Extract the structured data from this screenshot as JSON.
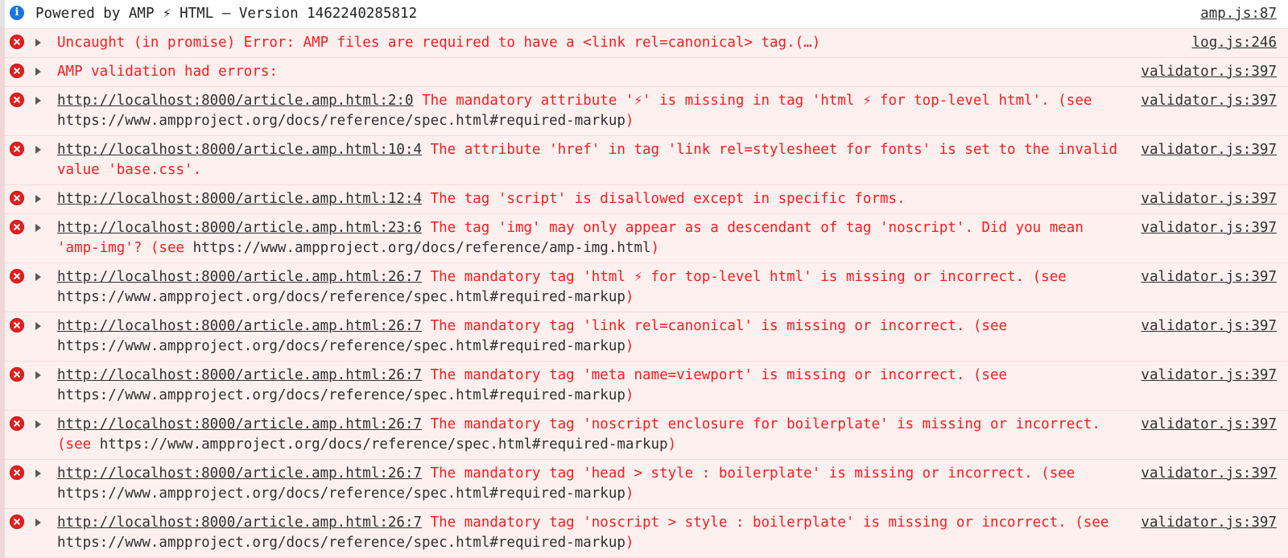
{
  "console": {
    "rows": [
      {
        "level": "info",
        "icon": "info-circle-icon",
        "has_arrow": false,
        "message": "Powered by AMP ⚡ HTML – Version 1462240285812",
        "source": "amp.js:87"
      },
      {
        "level": "error",
        "icon": "error-circle-icon",
        "has_arrow": true,
        "message": "Uncaught (in promise) Error: AMP files are required to have a <link rel=canonical> tag.(…)",
        "source": "log.js:246"
      },
      {
        "level": "error",
        "icon": "error-circle-icon",
        "has_arrow": true,
        "message": "AMP validation had errors:",
        "source": "validator.js:397"
      },
      {
        "level": "error",
        "icon": "error-circle-icon",
        "has_arrow": true,
        "location": "http://localhost:8000/article.amp.html:2:0",
        "message": "The mandatory attribute '⚡' is missing in tag 'html ⚡ for top-level html'. (see ",
        "url": "https://www.ampproject.org/docs/reference/spec.html#required-markup",
        "message_tail": ")",
        "source": "validator.js:397"
      },
      {
        "level": "error",
        "icon": "error-circle-icon",
        "has_arrow": true,
        "location": "http://localhost:8000/article.amp.html:10:4",
        "message": "The attribute 'href' in tag 'link rel=stylesheet for fonts' is set to the invalid value 'base.css'.",
        "url": "",
        "message_tail": "",
        "source": "validator.js:397"
      },
      {
        "level": "error",
        "icon": "error-circle-icon",
        "has_arrow": true,
        "location": "http://localhost:8000/article.amp.html:12:4",
        "message": "The tag 'script' is disallowed except in specific forms.",
        "url": "",
        "message_tail": "",
        "source": "validator.js:397"
      },
      {
        "level": "error",
        "icon": "error-circle-icon",
        "has_arrow": true,
        "location": "http://localhost:8000/article.amp.html:23:6",
        "message": "The tag 'img' may only appear as a descendant of tag 'noscript'. Did you mean 'amp-img'? (see ",
        "url": "https://www.ampproject.org/docs/reference/amp-img.html",
        "message_tail": ")",
        "source": "validator.js:397"
      },
      {
        "level": "error",
        "icon": "error-circle-icon",
        "has_arrow": true,
        "location": "http://localhost:8000/article.amp.html:26:7",
        "message": "The mandatory tag 'html ⚡ for top-level html' is missing or incorrect. (see ",
        "url": "https://www.ampproject.org/docs/reference/spec.html#required-markup",
        "message_tail": ")",
        "source": "validator.js:397"
      },
      {
        "level": "error",
        "icon": "error-circle-icon",
        "has_arrow": true,
        "location": "http://localhost:8000/article.amp.html:26:7",
        "message": "The mandatory tag 'link rel=canonical' is missing or incorrect. (see ",
        "url": "https://www.ampproject.org/docs/reference/spec.html#required-markup",
        "message_tail": ")",
        "source": "validator.js:397"
      },
      {
        "level": "error",
        "icon": "error-circle-icon",
        "has_arrow": true,
        "location": "http://localhost:8000/article.amp.html:26:7",
        "message": "The mandatory tag 'meta name=viewport' is missing or incorrect. (see ",
        "url": "https://www.ampproject.org/docs/reference/spec.html#required-markup",
        "message_tail": ")",
        "source": "validator.js:397"
      },
      {
        "level": "error",
        "icon": "error-circle-icon",
        "has_arrow": true,
        "location": "http://localhost:8000/article.amp.html:26:7",
        "message": "The mandatory tag 'noscript enclosure for boilerplate' is missing or incorrect. (see ",
        "url": "https://www.ampproject.org/docs/reference/spec.html#required-markup",
        "message_tail": ")",
        "source": "validator.js:397"
      },
      {
        "level": "error",
        "icon": "error-circle-icon",
        "has_arrow": true,
        "location": "http://localhost:8000/article.amp.html:26:7",
        "message": "The mandatory tag 'head > style : boilerplate' is missing or incorrect. (see ",
        "url": "https://www.ampproject.org/docs/reference/spec.html#required-markup",
        "message_tail": ")",
        "source": "validator.js:397"
      },
      {
        "level": "error",
        "icon": "error-circle-icon",
        "has_arrow": true,
        "location": "http://localhost:8000/article.amp.html:26:7",
        "message": "The mandatory tag 'noscript > style : boilerplate' is missing or incorrect. (see ",
        "url": "https://www.ampproject.org/docs/reference/spec.html#required-markup",
        "message_tail": ")",
        "source": "validator.js:397"
      }
    ],
    "colors": {
      "error_text": "#ff1c1c",
      "error_row_bg": "#fff0f0",
      "error_icon": "#e02020",
      "info_icon": "#1a73e8",
      "link_text": "#303030"
    }
  }
}
